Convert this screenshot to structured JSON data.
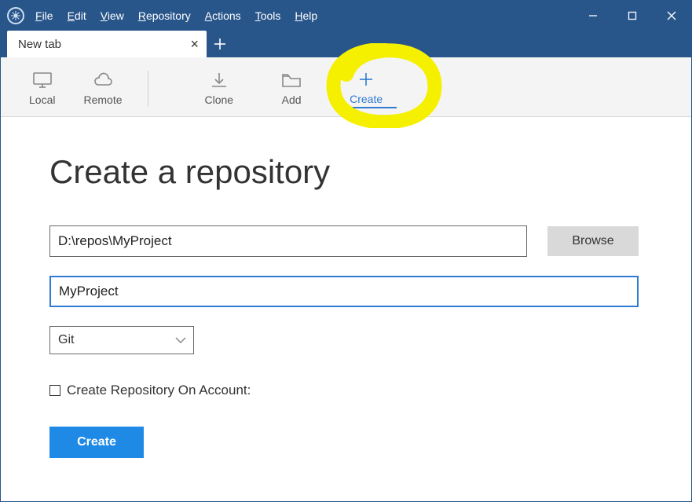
{
  "menubar": {
    "file": "File",
    "edit": "Edit",
    "view": "View",
    "repository": "Repository",
    "actions": "Actions",
    "tools": "Tools",
    "help": "Help"
  },
  "tab": {
    "title": "New tab"
  },
  "toolbar": {
    "local": "Local",
    "remote": "Remote",
    "clone": "Clone",
    "add": "Add",
    "create": "Create"
  },
  "form": {
    "heading": "Create a repository",
    "path": "D:\\repos\\MyProject",
    "browse": "Browse",
    "name": "MyProject",
    "vcs": "Git",
    "checkbox_label": "Create Repository On Account:",
    "submit": "Create"
  }
}
